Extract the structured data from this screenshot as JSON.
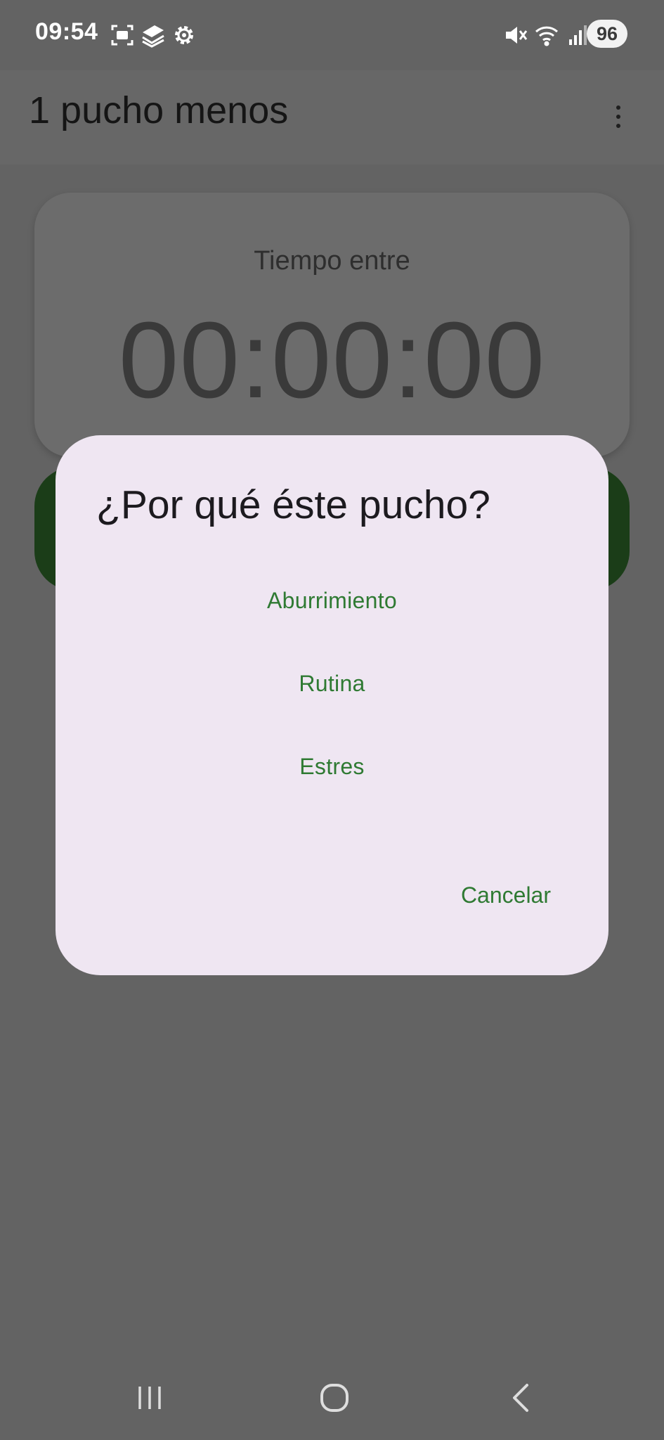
{
  "status_bar": {
    "time": "09:54",
    "left_icons": [
      "screenshot-icon",
      "stack-icon",
      "settings-icon"
    ],
    "right_icons": [
      "mute-icon",
      "wifi-icon",
      "signal-icon"
    ],
    "battery": "96"
  },
  "app_bar": {
    "title": "1 pucho menos",
    "menu_icon": "overflow-menu-icon"
  },
  "timer_card": {
    "label": "Tiempo entre",
    "value": "00:00:00"
  },
  "dialog": {
    "title": "¿Por qué éste pucho?",
    "options": [
      {
        "label": "Aburrimiento"
      },
      {
        "label": "Rutina"
      },
      {
        "label": "Estres"
      }
    ],
    "cancel_label": "Cancelar"
  },
  "nav_bar": {
    "icons": [
      "recent-apps-icon",
      "home-icon",
      "back-icon"
    ]
  },
  "colors": {
    "scrim": "#636363",
    "dialog_bg": "#efe6f2",
    "accent": "#2f7a33",
    "dark_green": "#1b3d18"
  }
}
